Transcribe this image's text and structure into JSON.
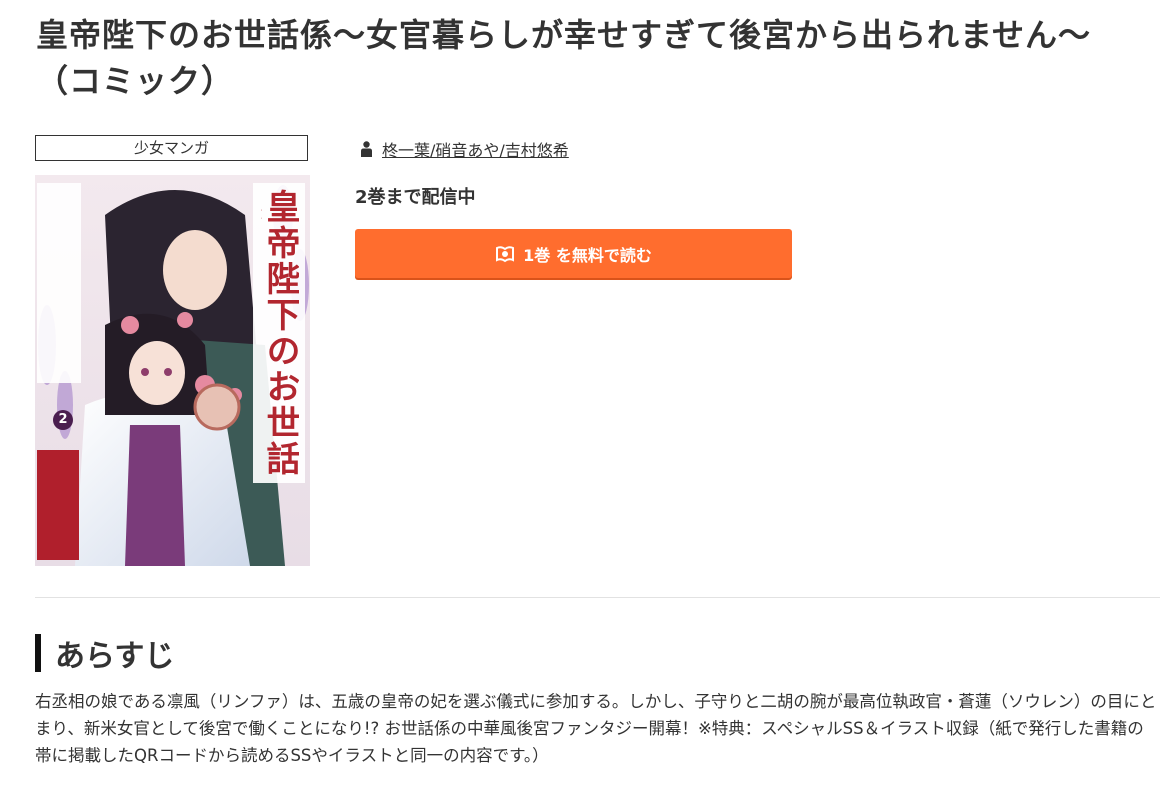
{
  "title": "皇帝陛下のお世話係〜女官暮らしが幸せすぎて後宮から出られません〜（コミック）",
  "genre": "少女マンガ",
  "author": {
    "icon": "person-icon",
    "names": "柊一葉/硝音あや/吉村悠希"
  },
  "volumes_text": "2巻まで配信中",
  "read_button": {
    "icon": "book-icon",
    "label": "1巻 を無料で読む",
    "color": "#ff6d2e"
  },
  "cover": {
    "title_vertical": "皇帝陛下のお世話係",
    "volume_number": "2"
  },
  "synopsis": {
    "heading": "あらすじ",
    "text": "右丞相の娘である凛風（リンファ）は、五歳の皇帝の妃を選ぶ儀式に参加する。しかし、子守りと二胡の腕が最高位執政官・蒼蓮（ソウレン）の目にとまり、新米女官として後宮で働くことになり!? お世話係の中華風後宮ファンタジー開幕！※特典：スペシャルSS＆イラスト収録（紙で発行した書籍の帯に掲載したQRコードから読めるSSやイラストと同一の内容です。）"
  }
}
